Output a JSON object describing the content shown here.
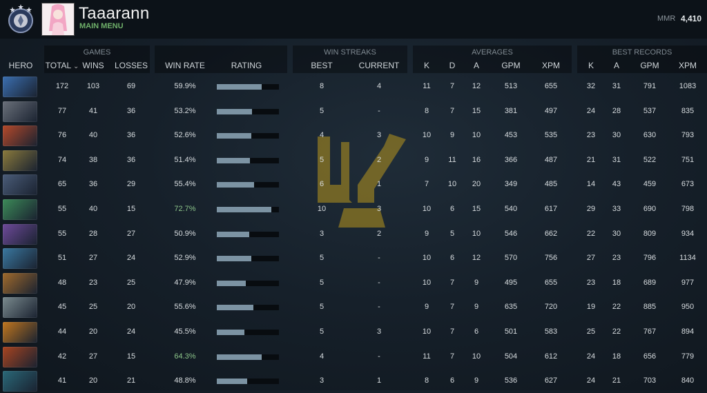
{
  "profile": {
    "name": "Taaarann",
    "subtitle": "MAIN MENU",
    "mmr_label": "MMR",
    "mmr_value": "4,410"
  },
  "groups": {
    "games": "GAMES",
    "win_streaks": "WIN STREAKS",
    "averages": "AVERAGES",
    "best_records": "BEST RECORDS"
  },
  "columns": {
    "hero": "HERO",
    "total": "TOTAL",
    "wins": "WINS",
    "losses": "LOSSES",
    "win_rate": "WIN RATE",
    "rating": "RATING",
    "best": "BEST",
    "current": "CURRENT",
    "avg_k": "K",
    "avg_d": "D",
    "avg_a": "A",
    "avg_gpm": "GPM",
    "avg_xpm": "XPM",
    "rec_k": "K",
    "rec_a": "A",
    "rec_gpm": "GPM",
    "rec_xpm": "XPM"
  },
  "colors": {
    "accent_green": "#6fb06a",
    "winrate_high": "#8cc58a",
    "rating_bar": "#7c93a3",
    "watermark": "#b8961e"
  },
  "rows": [
    {
      "hero_icon": "hero-portrait-1",
      "hero_color": "#3b6fb0",
      "total": "172",
      "wins": "103",
      "losses": "69",
      "win_rate": "59.9%",
      "rating": 0.72,
      "best": "8",
      "current": "4",
      "k": "11",
      "d": "7",
      "a": "12",
      "gpm": "513",
      "xpm": "655",
      "rk": "32",
      "ra": "31",
      "rgpm": "791",
      "rxpm": "1083",
      "wr_high": false
    },
    {
      "hero_icon": "hero-portrait-2",
      "hero_color": "#6a707a",
      "total": "77",
      "wins": "41",
      "losses": "36",
      "win_rate": "53.2%",
      "rating": 0.57,
      "best": "5",
      "current": "-",
      "k": "8",
      "d": "7",
      "a": "15",
      "gpm": "381",
      "xpm": "497",
      "rk": "24",
      "ra": "28",
      "rgpm": "537",
      "rxpm": "835",
      "wr_high": false
    },
    {
      "hero_icon": "hero-portrait-3",
      "hero_color": "#b5492a",
      "total": "76",
      "wins": "40",
      "losses": "36",
      "win_rate": "52.6%",
      "rating": 0.55,
      "best": "4",
      "current": "3",
      "k": "10",
      "d": "9",
      "a": "10",
      "gpm": "453",
      "xpm": "535",
      "rk": "23",
      "ra": "30",
      "rgpm": "630",
      "rxpm": "793",
      "wr_high": false
    },
    {
      "hero_icon": "hero-portrait-4",
      "hero_color": "#8a7a3c",
      "total": "74",
      "wins": "38",
      "losses": "36",
      "win_rate": "51.4%",
      "rating": 0.53,
      "best": "5",
      "current": "2",
      "k": "9",
      "d": "11",
      "a": "16",
      "gpm": "366",
      "xpm": "487",
      "rk": "21",
      "ra": "31",
      "rgpm": "522",
      "rxpm": "751",
      "wr_high": false
    },
    {
      "hero_icon": "hero-portrait-5",
      "hero_color": "#4a5c78",
      "total": "65",
      "wins": "36",
      "losses": "29",
      "win_rate": "55.4%",
      "rating": 0.6,
      "best": "6",
      "current": "1",
      "k": "7",
      "d": "10",
      "a": "20",
      "gpm": "349",
      "xpm": "485",
      "rk": "14",
      "ra": "43",
      "rgpm": "459",
      "rxpm": "673",
      "wr_high": false
    },
    {
      "hero_icon": "hero-portrait-6",
      "hero_color": "#3c8a58",
      "total": "55",
      "wins": "40",
      "losses": "15",
      "win_rate": "72.7%",
      "rating": 0.88,
      "best": "10",
      "current": "3",
      "k": "10",
      "d": "6",
      "a": "15",
      "gpm": "540",
      "xpm": "617",
      "rk": "29",
      "ra": "33",
      "rgpm": "690",
      "rxpm": "798",
      "wr_high": true
    },
    {
      "hero_icon": "hero-portrait-7",
      "hero_color": "#6e4a9a",
      "total": "55",
      "wins": "28",
      "losses": "27",
      "win_rate": "50.9%",
      "rating": 0.52,
      "best": "3",
      "current": "2",
      "k": "9",
      "d": "5",
      "a": "10",
      "gpm": "546",
      "xpm": "662",
      "rk": "22",
      "ra": "30",
      "rgpm": "809",
      "rxpm": "934",
      "wr_high": false
    },
    {
      "hero_icon": "hero-portrait-8",
      "hero_color": "#3a78a0",
      "total": "51",
      "wins": "27",
      "losses": "24",
      "win_rate": "52.9%",
      "rating": 0.56,
      "best": "5",
      "current": "-",
      "k": "10",
      "d": "6",
      "a": "12",
      "gpm": "570",
      "xpm": "756",
      "rk": "27",
      "ra": "23",
      "rgpm": "796",
      "rxpm": "1134",
      "wr_high": false
    },
    {
      "hero_icon": "hero-portrait-9",
      "hero_color": "#a06a2c",
      "total": "48",
      "wins": "23",
      "losses": "25",
      "win_rate": "47.9%",
      "rating": 0.47,
      "best": "5",
      "current": "-",
      "k": "10",
      "d": "7",
      "a": "9",
      "gpm": "495",
      "xpm": "655",
      "rk": "23",
      "ra": "18",
      "rgpm": "689",
      "rxpm": "977",
      "wr_high": false
    },
    {
      "hero_icon": "hero-portrait-10",
      "hero_color": "#7a8a8e",
      "total": "45",
      "wins": "25",
      "losses": "20",
      "win_rate": "55.6%",
      "rating": 0.59,
      "best": "5",
      "current": "-",
      "k": "9",
      "d": "7",
      "a": "9",
      "gpm": "635",
      "xpm": "720",
      "rk": "19",
      "ra": "22",
      "rgpm": "885",
      "rxpm": "950",
      "wr_high": false
    },
    {
      "hero_icon": "hero-portrait-11",
      "hero_color": "#c0761e",
      "total": "44",
      "wins": "20",
      "losses": "24",
      "win_rate": "45.5%",
      "rating": 0.44,
      "best": "5",
      "current": "3",
      "k": "10",
      "d": "7",
      "a": "6",
      "gpm": "501",
      "xpm": "583",
      "rk": "25",
      "ra": "22",
      "rgpm": "767",
      "rxpm": "894",
      "wr_high": false
    },
    {
      "hero_icon": "hero-portrait-12",
      "hero_color": "#a84420",
      "total": "42",
      "wins": "27",
      "losses": "15",
      "win_rate": "64.3%",
      "rating": 0.72,
      "best": "4",
      "current": "-",
      "k": "11",
      "d": "7",
      "a": "10",
      "gpm": "504",
      "xpm": "612",
      "rk": "24",
      "ra": "18",
      "rgpm": "656",
      "rxpm": "779",
      "wr_high": true
    },
    {
      "hero_icon": "hero-portrait-13",
      "hero_color": "#2a6878",
      "total": "41",
      "wins": "20",
      "losses": "21",
      "win_rate": "48.8%",
      "rating": 0.49,
      "best": "3",
      "current": "1",
      "k": "8",
      "d": "6",
      "a": "9",
      "gpm": "536",
      "xpm": "627",
      "rk": "24",
      "ra": "21",
      "rgpm": "703",
      "rxpm": "840",
      "wr_high": false
    }
  ]
}
